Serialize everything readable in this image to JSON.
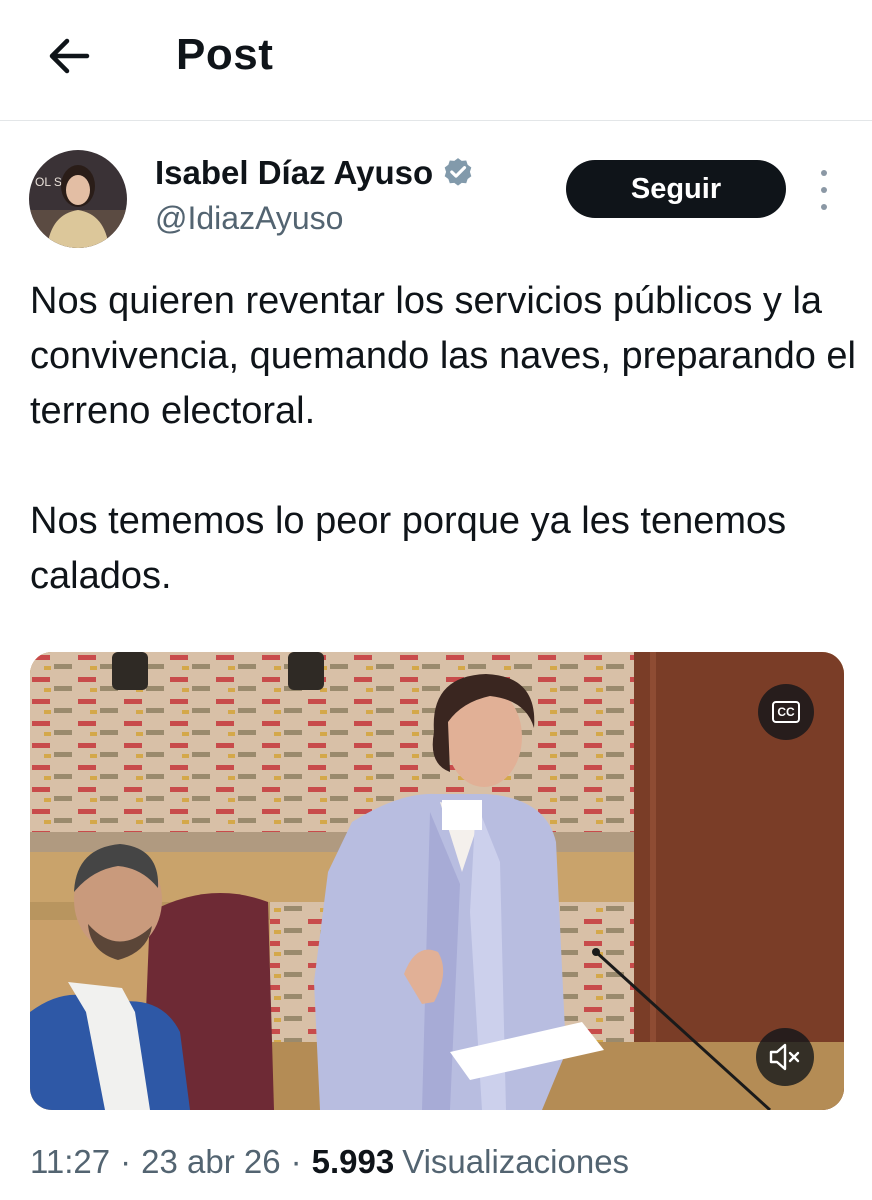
{
  "header": {
    "title": "Post",
    "back_icon": "arrow-left-icon"
  },
  "author": {
    "name": "Isabel Díaz Ayuso",
    "handle": "@IdiazAyuso",
    "verified_icon": "verified-badge-icon",
    "avatar_text": "OL SIVE"
  },
  "follow_button": {
    "label": "Seguir"
  },
  "tweet": {
    "paragraphs": [
      "Nos quieren reventar los servicios públicos y la convivencia, quemando las naves, preparando el terreno electoral.",
      "Nos tememos lo peor porque ya les tenemos calados."
    ]
  },
  "media": {
    "cc_label": "CC",
    "cc_icon": "closed-captions-icon",
    "mute_icon": "volume-muted-icon"
  },
  "meta": {
    "time": "11:27",
    "separator": "·",
    "date": "23 abr 26",
    "views_count": "5.993",
    "views_label": "Visualizaciones"
  },
  "colors": {
    "accent_dark": "#0f1419",
    "secondary_text": "#536471",
    "verified": "#829aab"
  }
}
